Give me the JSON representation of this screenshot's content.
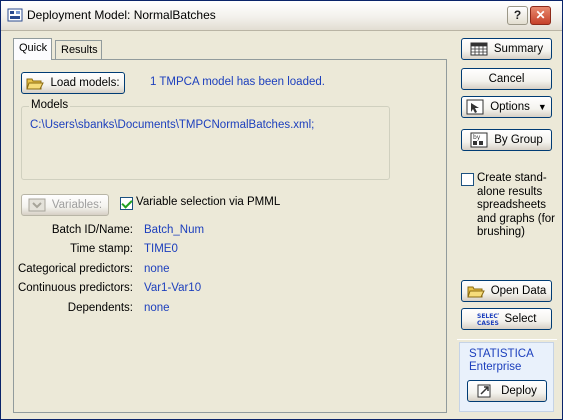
{
  "window": {
    "title": "Deployment Model: NormalBatches",
    "help_label": "?",
    "close_label": "✕"
  },
  "tabs": [
    {
      "label": "Quick",
      "active": true
    },
    {
      "label": "Results",
      "active": false
    }
  ],
  "quick": {
    "load_models_label": "Load models:",
    "loaded_message": "1 TMPCA model has been loaded.",
    "models_group_title": "Models",
    "models_path": "C:\\Users\\sbanks\\Documents\\TMPCNormalBatches.xml;",
    "variables_label": "Variables:",
    "variable_selection_label": "Variable selection via PMML",
    "variable_selection_checked": true,
    "fields": [
      {
        "label": "Batch ID/Name:",
        "value": "Batch_Num"
      },
      {
        "label": "Time stamp:",
        "value": "TIME0"
      },
      {
        "label": "Categorical predictors:",
        "value": "none"
      },
      {
        "label": "Continuous predictors:",
        "value": "Var1-Var10"
      },
      {
        "label": "Dependents:",
        "value": "none"
      }
    ]
  },
  "side": {
    "summary_label": "Summary",
    "cancel_label": "Cancel",
    "options_label": "Options",
    "bygroup_label": "By Group",
    "create_label": "Create stand-alone results spreadsheets and graphs (for brushing)",
    "create_checked": false,
    "open_data_label": "Open Data",
    "select_label": "Select",
    "enterprise_line1": "STATISTICA",
    "enterprise_line2": "Enterprise",
    "deploy_label": "Deploy"
  },
  "colors": {
    "accent_text": "#1c3fbd",
    "window_bg": "#ece9d8",
    "button_border": "#003c74"
  }
}
